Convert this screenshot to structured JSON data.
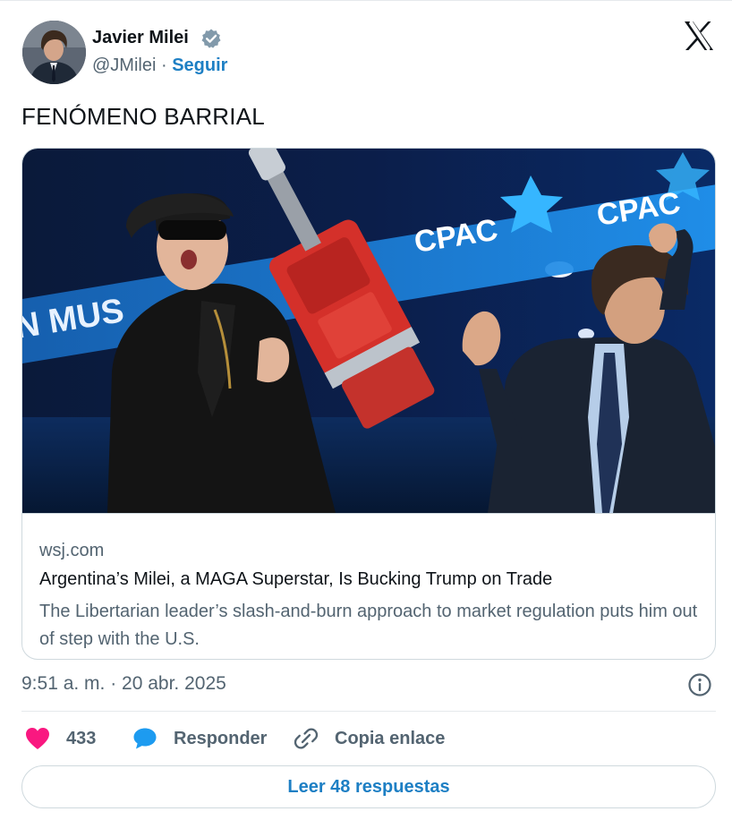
{
  "author": {
    "name": "Javier Milei",
    "handle": "@JMilei",
    "separator": " · ",
    "follow_label": "Seguir"
  },
  "tweet": {
    "text": "FENÓMENO BARRIAL",
    "timestamp": "9:51 a. m. · 20 abr. 2025"
  },
  "link_card": {
    "domain": "wsj.com",
    "title": "Argentina’s Milei, a MAGA Superstar, Is Bucking Trump on Trade",
    "description": "The Libertarian leader’s slash-and-burn approach to market regulation puts him out of step with the U.S.",
    "image_signage": [
      "CPAC",
      "CPAC",
      "N MUS"
    ]
  },
  "actions": {
    "likes_count": "433",
    "reply_label": "Responder",
    "copy_label": "Copia enlace",
    "read_replies_label": "Leer 48 respuestas"
  },
  "icons": {
    "verified": "verified-badge-icon",
    "logo": "x-logo-icon",
    "info": "info-icon",
    "like": "heart-icon",
    "reply": "speech-bubble-icon",
    "copy": "link-icon"
  },
  "colors": {
    "accent": "#1d7fc4",
    "like": "#f91880",
    "reply": "#1d9bf0",
    "secondary_text": "#536471",
    "border": "#cfd9de"
  }
}
